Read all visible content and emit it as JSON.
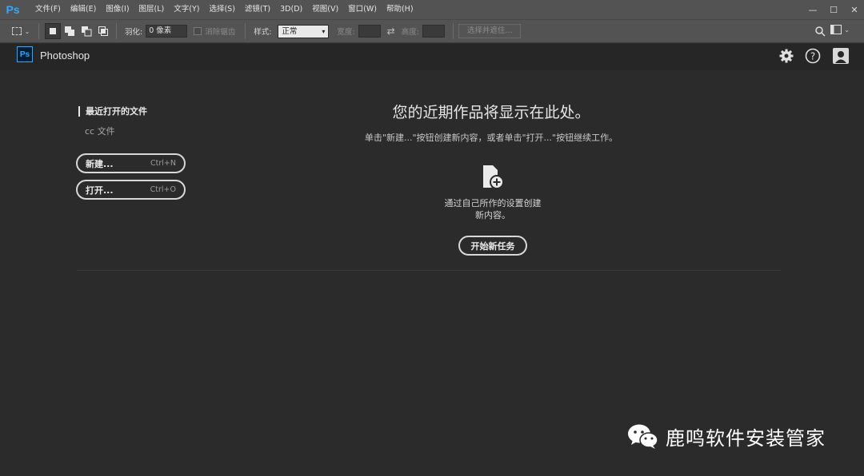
{
  "app": {
    "logo": "Ps",
    "name": "Photoshop"
  },
  "menu": [
    "文件(F)",
    "编辑(E)",
    "图像(I)",
    "图层(L)",
    "文字(Y)",
    "选择(S)",
    "滤镜(T)",
    "3D(D)",
    "视图(V)",
    "窗口(W)",
    "帮助(H)"
  ],
  "window_controls": {
    "minimize": "—",
    "maximize": "☐",
    "close": "✕"
  },
  "options": {
    "feather_label": "羽化:",
    "feather_value": "0 像素",
    "antialias_label": "消除锯齿",
    "style_label": "样式:",
    "style_value": "正常",
    "width_label": "宽度:",
    "height_label": "高度:",
    "select_mask": "选择并遮住..."
  },
  "header_icons": [
    "gear-icon",
    "help-icon",
    "user-icon"
  ],
  "left": {
    "recent_title": "最近打开的文件",
    "cc_files": "cc 文件",
    "new_label": "新建...",
    "new_shortcut": "Ctrl+N",
    "open_label": "打开...",
    "open_shortcut": "Ctrl+O"
  },
  "main": {
    "title": "您的近期作品将显示在此处。",
    "subtitle": "单击\"新建...\"按钮创建新内容，或者单击\"打开...\"按钮继续工作。",
    "create_text_1": "通过自己所作的设置创建",
    "create_text_2": "新内容。",
    "start_button": "开始新任务"
  },
  "watermark": {
    "text": "鹿鸣软件安装管家"
  },
  "colors": {
    "ps_blue": "#31a8ff",
    "panel_bg": "#2b2b2b",
    "bar_bg": "#535353",
    "header_bg": "#262626"
  }
}
